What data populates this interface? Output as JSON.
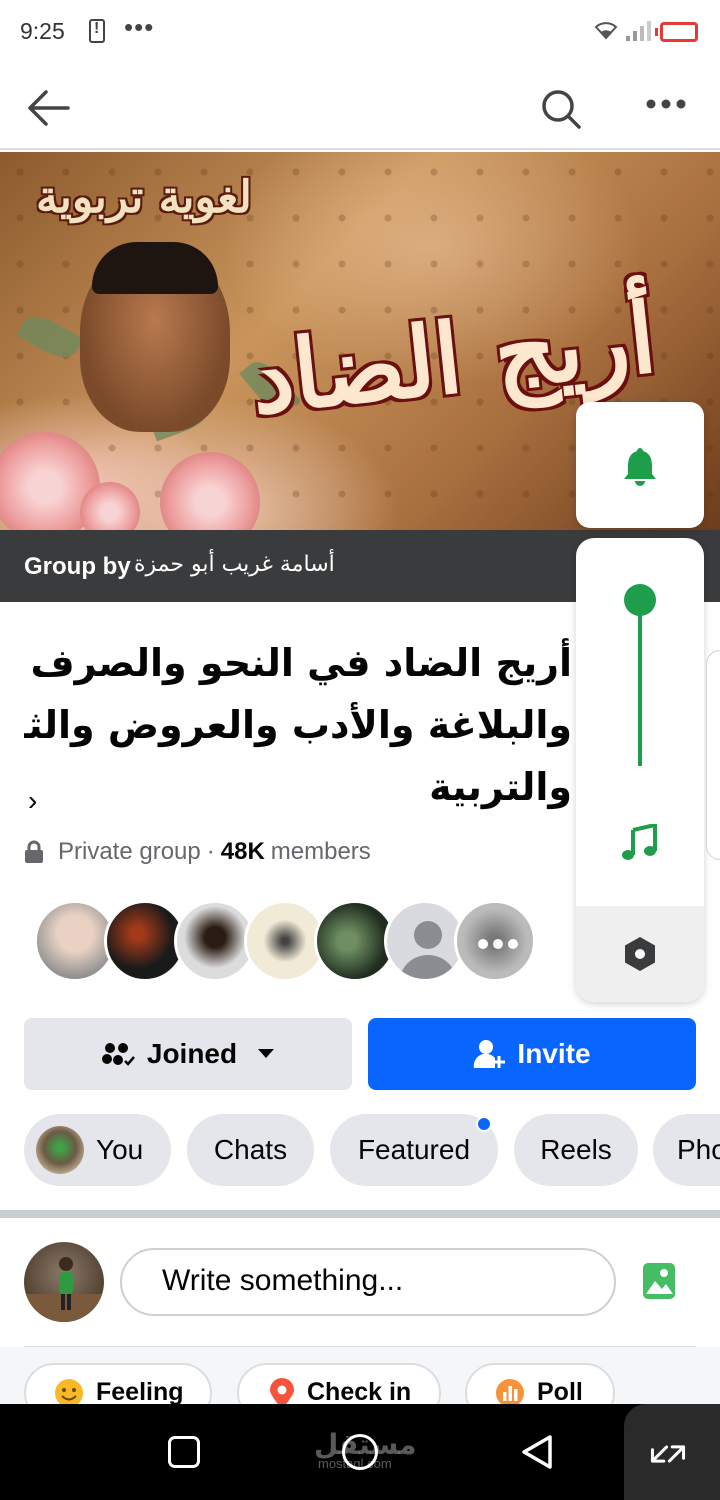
{
  "status_bar": {
    "time": "9:25"
  },
  "cover": {
    "subtitle": "لغوية تربوية",
    "title": "أريج الضاد"
  },
  "group_by": {
    "label": "Group by",
    "name": "أسامة غريب أبو حمزة"
  },
  "group": {
    "title_lines": [
      "أريج الضاد في النحو والصرف",
      "والبلاغة والأدب والعروض والثقافة",
      "والتربية"
    ],
    "privacy": "Private group",
    "separator": "·",
    "members_count": "48K",
    "members_label": "members"
  },
  "buttons": {
    "joined": "Joined",
    "invite": "Invite"
  },
  "tabs": [
    "You",
    "Chats",
    "Featured",
    "Reels",
    "Pho"
  ],
  "composer": {
    "placeholder": "Write something..."
  },
  "actions": [
    "Feeling",
    "Check in",
    "Poll"
  ],
  "watermark": {
    "text": "مستقل",
    "sub": "mostaql.com"
  },
  "colors": {
    "accent": "#0866ff",
    "widget_green": "#1e9e4a",
    "cover_bar": "#3a3b3c"
  }
}
